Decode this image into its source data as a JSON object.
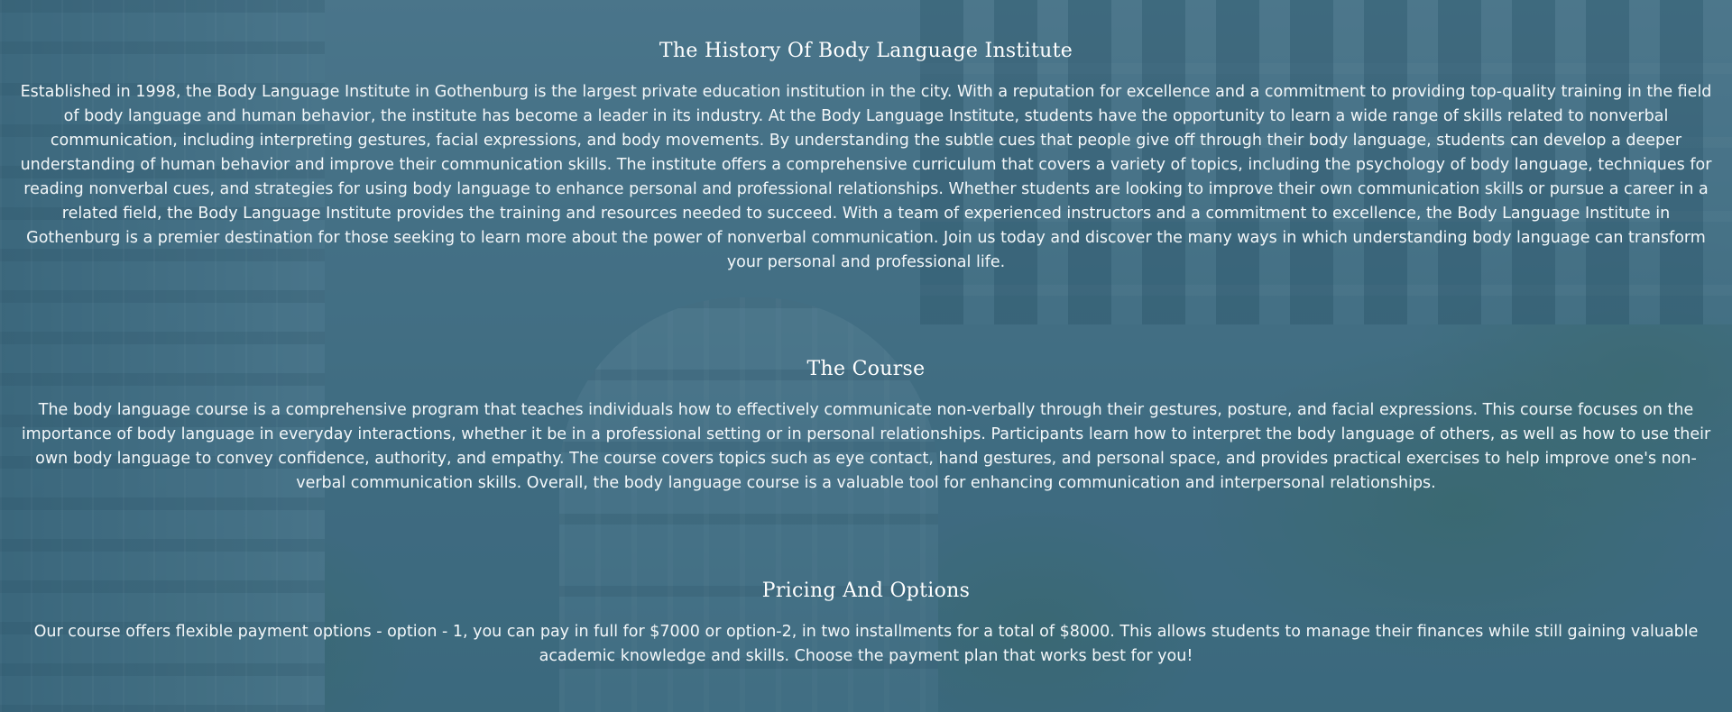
{
  "sections": {
    "history": {
      "title": "The History Of Body Language Institute",
      "body": "Established in 1998, the Body Language Institute in Gothenburg is the largest private education institution in the city. With a reputation for excellence and a commitment to providing top-quality training in the field of body language and human behavior, the institute has become a leader in its industry. At the Body Language Institute, students have the opportunity to learn a wide range of skills related to nonverbal communication, including interpreting gestures, facial expressions, and body movements. By understanding the subtle cues that people give off through their body language, students can develop a deeper understanding of human behavior and improve their communication skills. The institute offers a comprehensive curriculum that covers a variety of topics, including the psychology of body language, techniques for reading nonverbal cues, and strategies for using body language to enhance personal and professional relationships. Whether students are looking to improve their own communication skills or pursue a career in a related field, the Body Language Institute provides the training and resources needed to succeed. With a team of experienced instructors and a commitment to excellence, the Body Language Institute in Gothenburg is a premier destination for those seeking to learn more about the power of nonverbal communication. Join us today and discover the many ways in which understanding body language can transform your personal and professional life."
    },
    "course": {
      "title": "The Course",
      "body": "The body language course is a comprehensive program that teaches individuals how to effectively communicate non-verbally through their gestures, posture, and facial expressions. This course focuses on the importance of body language in everyday interactions, whether it be in a professional setting or in personal relationships. Participants learn how to interpret the body language of others, as well as how to use their own body language to convey confidence, authority, and empathy. The course covers topics such as eye contact, hand gestures, and personal space, and provides practical exercises to help improve one's non-verbal communication skills. Overall, the body language course is a valuable tool for enhancing communication and interpersonal relationships."
    },
    "pricing": {
      "title": "Pricing And Options",
      "body": "Our course offers flexible payment options - option - 1, you can pay in full for $7000 or option-2, in two installments for a total of $8000. This allows students to manage their finances while still gaining valuable academic knowledge and skills. Choose the payment plan that works best for you!"
    }
  },
  "colors": {
    "overlay": "#2c6078",
    "text": "#f3f7f9",
    "heading": "#ffffff"
  }
}
